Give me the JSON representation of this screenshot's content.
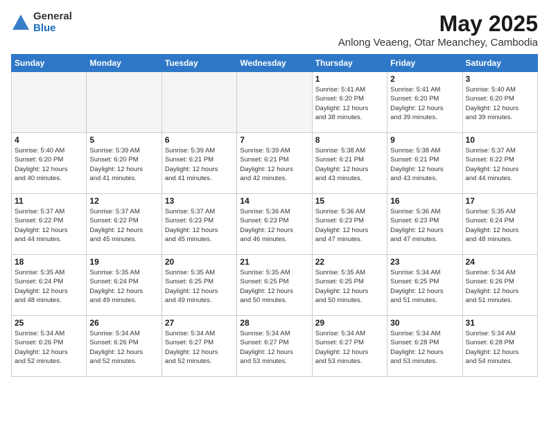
{
  "logo": {
    "general": "General",
    "blue": "Blue"
  },
  "header": {
    "month_year": "May 2025",
    "location": "Anlong Veaeng, Otar Meanchey, Cambodia"
  },
  "weekdays": [
    "Sunday",
    "Monday",
    "Tuesday",
    "Wednesday",
    "Thursday",
    "Friday",
    "Saturday"
  ],
  "weeks": [
    [
      {
        "day": "",
        "info": ""
      },
      {
        "day": "",
        "info": ""
      },
      {
        "day": "",
        "info": ""
      },
      {
        "day": "",
        "info": ""
      },
      {
        "day": "1",
        "info": "Sunrise: 5:41 AM\nSunset: 6:20 PM\nDaylight: 12 hours\nand 38 minutes."
      },
      {
        "day": "2",
        "info": "Sunrise: 5:41 AM\nSunset: 6:20 PM\nDaylight: 12 hours\nand 39 minutes."
      },
      {
        "day": "3",
        "info": "Sunrise: 5:40 AM\nSunset: 6:20 PM\nDaylight: 12 hours\nand 39 minutes."
      }
    ],
    [
      {
        "day": "4",
        "info": "Sunrise: 5:40 AM\nSunset: 6:20 PM\nDaylight: 12 hours\nand 40 minutes."
      },
      {
        "day": "5",
        "info": "Sunrise: 5:39 AM\nSunset: 6:20 PM\nDaylight: 12 hours\nand 41 minutes."
      },
      {
        "day": "6",
        "info": "Sunrise: 5:39 AM\nSunset: 6:21 PM\nDaylight: 12 hours\nand 41 minutes."
      },
      {
        "day": "7",
        "info": "Sunrise: 5:39 AM\nSunset: 6:21 PM\nDaylight: 12 hours\nand 42 minutes."
      },
      {
        "day": "8",
        "info": "Sunrise: 5:38 AM\nSunset: 6:21 PM\nDaylight: 12 hours\nand 43 minutes."
      },
      {
        "day": "9",
        "info": "Sunrise: 5:38 AM\nSunset: 6:21 PM\nDaylight: 12 hours\nand 43 minutes."
      },
      {
        "day": "10",
        "info": "Sunrise: 5:37 AM\nSunset: 6:22 PM\nDaylight: 12 hours\nand 44 minutes."
      }
    ],
    [
      {
        "day": "11",
        "info": "Sunrise: 5:37 AM\nSunset: 6:22 PM\nDaylight: 12 hours\nand 44 minutes."
      },
      {
        "day": "12",
        "info": "Sunrise: 5:37 AM\nSunset: 6:22 PM\nDaylight: 12 hours\nand 45 minutes."
      },
      {
        "day": "13",
        "info": "Sunrise: 5:37 AM\nSunset: 6:23 PM\nDaylight: 12 hours\nand 45 minutes."
      },
      {
        "day": "14",
        "info": "Sunrise: 5:36 AM\nSunset: 6:23 PM\nDaylight: 12 hours\nand 46 minutes."
      },
      {
        "day": "15",
        "info": "Sunrise: 5:36 AM\nSunset: 6:23 PM\nDaylight: 12 hours\nand 47 minutes."
      },
      {
        "day": "16",
        "info": "Sunrise: 5:36 AM\nSunset: 6:23 PM\nDaylight: 12 hours\nand 47 minutes."
      },
      {
        "day": "17",
        "info": "Sunrise: 5:35 AM\nSunset: 6:24 PM\nDaylight: 12 hours\nand 48 minutes."
      }
    ],
    [
      {
        "day": "18",
        "info": "Sunrise: 5:35 AM\nSunset: 6:24 PM\nDaylight: 12 hours\nand 48 minutes."
      },
      {
        "day": "19",
        "info": "Sunrise: 5:35 AM\nSunset: 6:24 PM\nDaylight: 12 hours\nand 49 minutes."
      },
      {
        "day": "20",
        "info": "Sunrise: 5:35 AM\nSunset: 6:25 PM\nDaylight: 12 hours\nand 49 minutes."
      },
      {
        "day": "21",
        "info": "Sunrise: 5:35 AM\nSunset: 6:25 PM\nDaylight: 12 hours\nand 50 minutes."
      },
      {
        "day": "22",
        "info": "Sunrise: 5:35 AM\nSunset: 6:25 PM\nDaylight: 12 hours\nand 50 minutes."
      },
      {
        "day": "23",
        "info": "Sunrise: 5:34 AM\nSunset: 6:25 PM\nDaylight: 12 hours\nand 51 minutes."
      },
      {
        "day": "24",
        "info": "Sunrise: 5:34 AM\nSunset: 6:26 PM\nDaylight: 12 hours\nand 51 minutes."
      }
    ],
    [
      {
        "day": "25",
        "info": "Sunrise: 5:34 AM\nSunset: 6:26 PM\nDaylight: 12 hours\nand 52 minutes."
      },
      {
        "day": "26",
        "info": "Sunrise: 5:34 AM\nSunset: 6:26 PM\nDaylight: 12 hours\nand 52 minutes."
      },
      {
        "day": "27",
        "info": "Sunrise: 5:34 AM\nSunset: 6:27 PM\nDaylight: 12 hours\nand 52 minutes."
      },
      {
        "day": "28",
        "info": "Sunrise: 5:34 AM\nSunset: 6:27 PM\nDaylight: 12 hours\nand 53 minutes."
      },
      {
        "day": "29",
        "info": "Sunrise: 5:34 AM\nSunset: 6:27 PM\nDaylight: 12 hours\nand 53 minutes."
      },
      {
        "day": "30",
        "info": "Sunrise: 5:34 AM\nSunset: 6:28 PM\nDaylight: 12 hours\nand 53 minutes."
      },
      {
        "day": "31",
        "info": "Sunrise: 5:34 AM\nSunset: 6:28 PM\nDaylight: 12 hours\nand 54 minutes."
      }
    ]
  ]
}
